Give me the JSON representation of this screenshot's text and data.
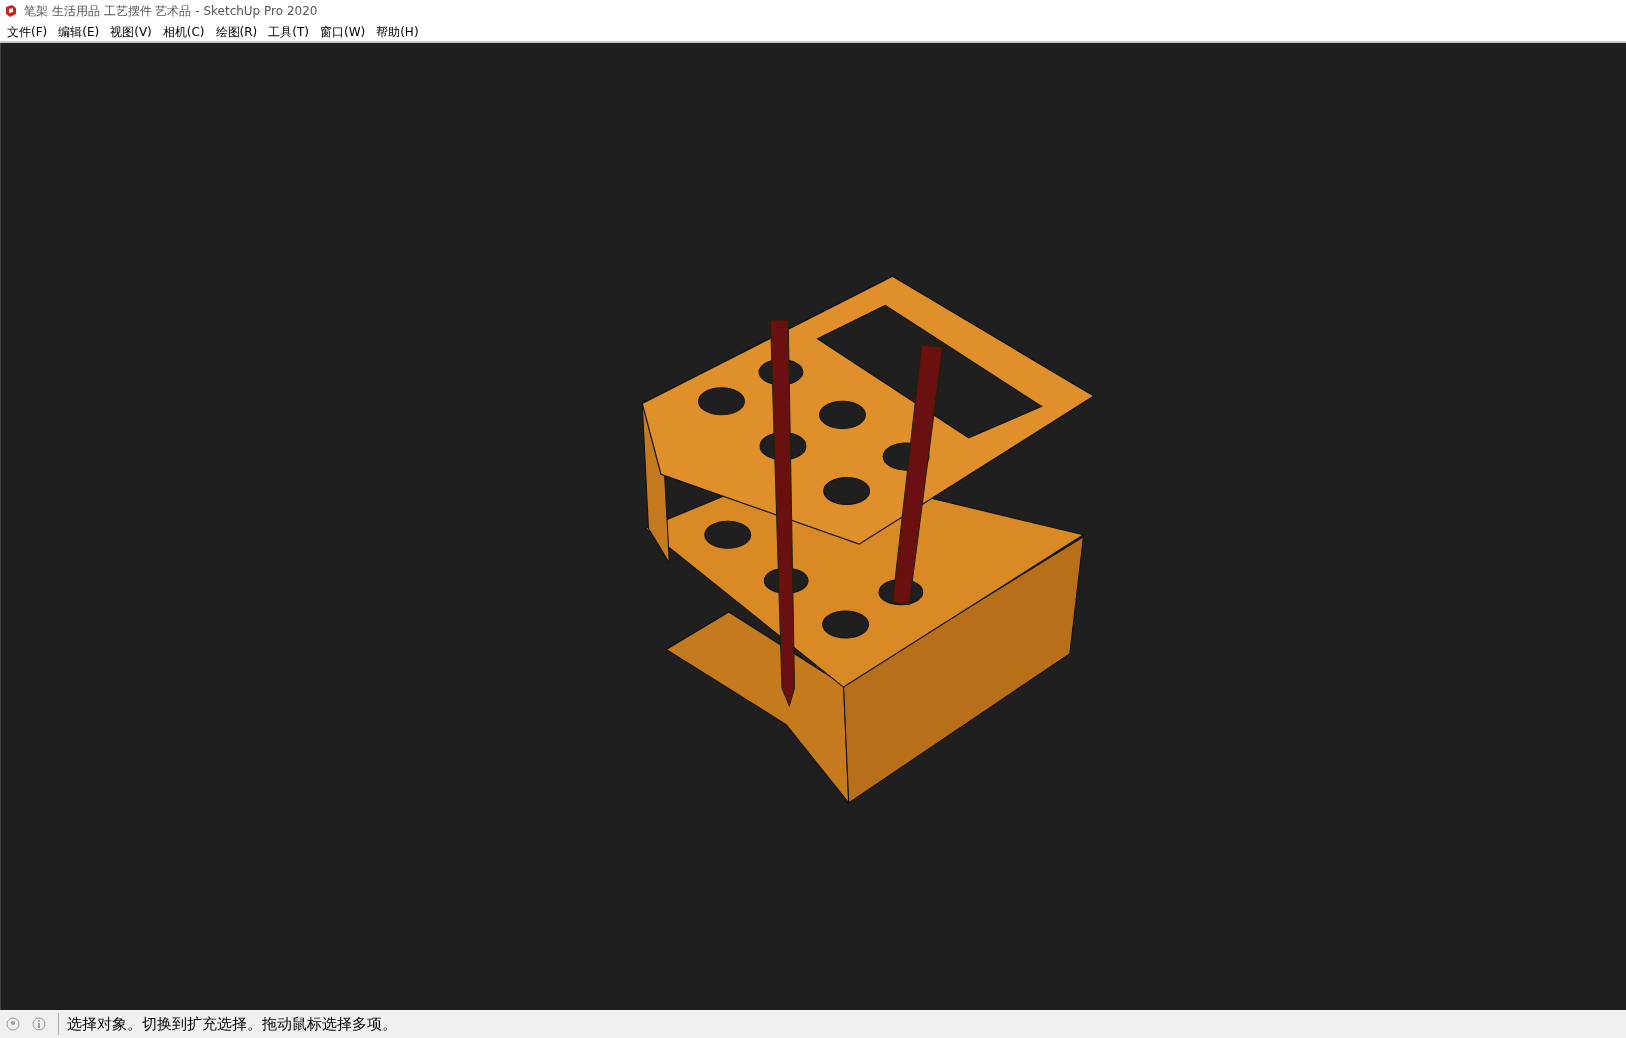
{
  "window": {
    "title": "笔架 生活用品 工艺摆件 艺术品 - SketchUp Pro 2020"
  },
  "menu": [
    "文件(F)",
    "编辑(E)",
    "视图(V)",
    "相机(C)",
    "绘图(R)",
    "工具(T)",
    "窗口(W)",
    "帮助(H)"
  ],
  "status_bar": {
    "message": "选择对象。切换到扩充选择。拖动鼠标选择多项。"
  }
}
